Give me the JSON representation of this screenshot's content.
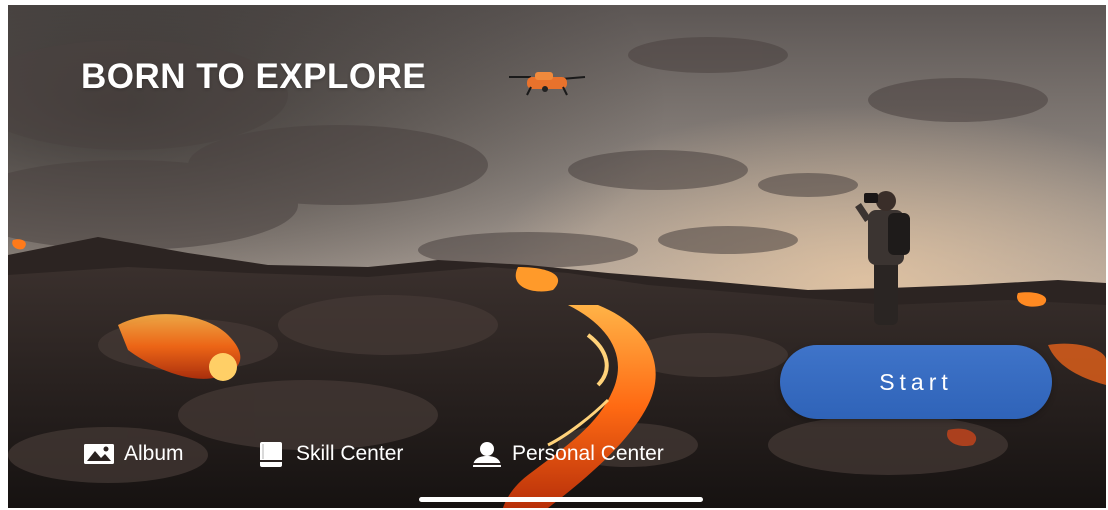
{
  "hero": {
    "title": "BORN TO EXPLORE",
    "drone_icon": "drone-icon",
    "background_description_colors": {
      "sky": "#8a7f78",
      "lava": "#ff7a1a",
      "rock": "#2a2220"
    }
  },
  "actions": {
    "start_label": "Start",
    "start_color": "#3a6cc2"
  },
  "nav": {
    "items": [
      {
        "label": "Album",
        "icon": "image-icon"
      },
      {
        "label": "Skill Center",
        "icon": "book-icon"
      },
      {
        "label": "Personal Center",
        "icon": "person-icon"
      }
    ]
  }
}
